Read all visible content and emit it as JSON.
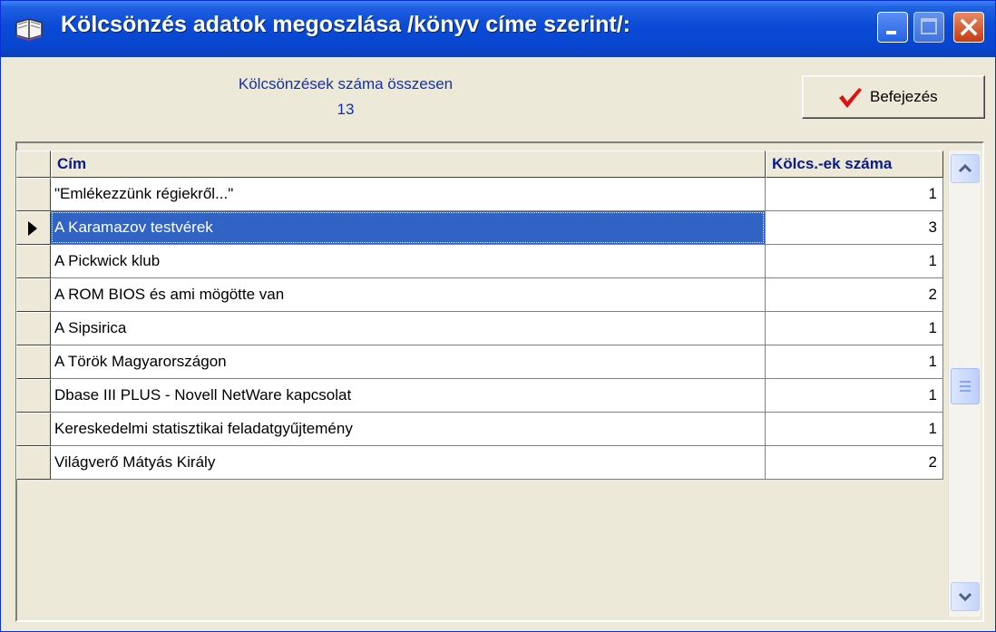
{
  "window": {
    "title": "Kölcsönzés adatok megoszlása /könyv címe szerint/:",
    "icon": "book-icon",
    "buttons": [
      "minimize",
      "maximize",
      "close"
    ]
  },
  "summary": {
    "label": "Kölcsönzések száma összesen",
    "total": "13"
  },
  "finish_button": {
    "label": "Befejezés",
    "icon": "checkmark-icon",
    "icon_color": "#e01010"
  },
  "grid": {
    "columns": [
      "Cím",
      "Kölcs.-ek száma"
    ],
    "rows": [
      {
        "title": "\"Emlékezzünk régiekről...\"",
        "count": "1"
      },
      {
        "title": "A Karamazov testvérek",
        "count": "3"
      },
      {
        "title": "A Pickwick klub",
        "count": "1"
      },
      {
        "title": "A ROM BIOS és ami mögötte van",
        "count": "2"
      },
      {
        "title": "A Sipsirica",
        "count": "1"
      },
      {
        "title": "A Török Magyarországon",
        "count": "1"
      },
      {
        "title": "Dbase III PLUS - Novell NetWare kapcsolat",
        "count": "1"
      },
      {
        "title": "Kereskedelmi statisztikai feladatgyűjtemény",
        "count": "1"
      },
      {
        "title": "Világverő Mátyás Király",
        "count": "2"
      }
    ],
    "selected_row": 1,
    "selection_color": "#3163c5"
  },
  "colors": {
    "titlebar": "#0a4ad6",
    "label_blue": "#1030b0",
    "header_text": "#0a1a8c"
  }
}
